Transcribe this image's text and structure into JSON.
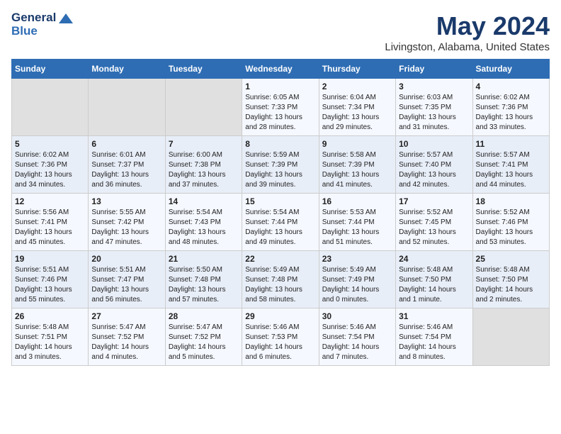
{
  "logo": {
    "line1": "General",
    "line2": "Blue"
  },
  "title": "May 2024",
  "subtitle": "Livingston, Alabama, United States",
  "days_header": [
    "Sunday",
    "Monday",
    "Tuesday",
    "Wednesday",
    "Thursday",
    "Friday",
    "Saturday"
  ],
  "weeks": [
    [
      {
        "day": "",
        "content": ""
      },
      {
        "day": "",
        "content": ""
      },
      {
        "day": "",
        "content": ""
      },
      {
        "day": "1",
        "content": "Sunrise: 6:05 AM\nSunset: 7:33 PM\nDaylight: 13 hours\nand 28 minutes."
      },
      {
        "day": "2",
        "content": "Sunrise: 6:04 AM\nSunset: 7:34 PM\nDaylight: 13 hours\nand 29 minutes."
      },
      {
        "day": "3",
        "content": "Sunrise: 6:03 AM\nSunset: 7:35 PM\nDaylight: 13 hours\nand 31 minutes."
      },
      {
        "day": "4",
        "content": "Sunrise: 6:02 AM\nSunset: 7:36 PM\nDaylight: 13 hours\nand 33 minutes."
      }
    ],
    [
      {
        "day": "5",
        "content": "Sunrise: 6:02 AM\nSunset: 7:36 PM\nDaylight: 13 hours\nand 34 minutes."
      },
      {
        "day": "6",
        "content": "Sunrise: 6:01 AM\nSunset: 7:37 PM\nDaylight: 13 hours\nand 36 minutes."
      },
      {
        "day": "7",
        "content": "Sunrise: 6:00 AM\nSunset: 7:38 PM\nDaylight: 13 hours\nand 37 minutes."
      },
      {
        "day": "8",
        "content": "Sunrise: 5:59 AM\nSunset: 7:39 PM\nDaylight: 13 hours\nand 39 minutes."
      },
      {
        "day": "9",
        "content": "Sunrise: 5:58 AM\nSunset: 7:39 PM\nDaylight: 13 hours\nand 41 minutes."
      },
      {
        "day": "10",
        "content": "Sunrise: 5:57 AM\nSunset: 7:40 PM\nDaylight: 13 hours\nand 42 minutes."
      },
      {
        "day": "11",
        "content": "Sunrise: 5:57 AM\nSunset: 7:41 PM\nDaylight: 13 hours\nand 44 minutes."
      }
    ],
    [
      {
        "day": "12",
        "content": "Sunrise: 5:56 AM\nSunset: 7:41 PM\nDaylight: 13 hours\nand 45 minutes."
      },
      {
        "day": "13",
        "content": "Sunrise: 5:55 AM\nSunset: 7:42 PM\nDaylight: 13 hours\nand 47 minutes."
      },
      {
        "day": "14",
        "content": "Sunrise: 5:54 AM\nSunset: 7:43 PM\nDaylight: 13 hours\nand 48 minutes."
      },
      {
        "day": "15",
        "content": "Sunrise: 5:54 AM\nSunset: 7:44 PM\nDaylight: 13 hours\nand 49 minutes."
      },
      {
        "day": "16",
        "content": "Sunrise: 5:53 AM\nSunset: 7:44 PM\nDaylight: 13 hours\nand 51 minutes."
      },
      {
        "day": "17",
        "content": "Sunrise: 5:52 AM\nSunset: 7:45 PM\nDaylight: 13 hours\nand 52 minutes."
      },
      {
        "day": "18",
        "content": "Sunrise: 5:52 AM\nSunset: 7:46 PM\nDaylight: 13 hours\nand 53 minutes."
      }
    ],
    [
      {
        "day": "19",
        "content": "Sunrise: 5:51 AM\nSunset: 7:46 PM\nDaylight: 13 hours\nand 55 minutes."
      },
      {
        "day": "20",
        "content": "Sunrise: 5:51 AM\nSunset: 7:47 PM\nDaylight: 13 hours\nand 56 minutes."
      },
      {
        "day": "21",
        "content": "Sunrise: 5:50 AM\nSunset: 7:48 PM\nDaylight: 13 hours\nand 57 minutes."
      },
      {
        "day": "22",
        "content": "Sunrise: 5:49 AM\nSunset: 7:48 PM\nDaylight: 13 hours\nand 58 minutes."
      },
      {
        "day": "23",
        "content": "Sunrise: 5:49 AM\nSunset: 7:49 PM\nDaylight: 14 hours\nand 0 minutes."
      },
      {
        "day": "24",
        "content": "Sunrise: 5:48 AM\nSunset: 7:50 PM\nDaylight: 14 hours\nand 1 minute."
      },
      {
        "day": "25",
        "content": "Sunrise: 5:48 AM\nSunset: 7:50 PM\nDaylight: 14 hours\nand 2 minutes."
      }
    ],
    [
      {
        "day": "26",
        "content": "Sunrise: 5:48 AM\nSunset: 7:51 PM\nDaylight: 14 hours\nand 3 minutes."
      },
      {
        "day": "27",
        "content": "Sunrise: 5:47 AM\nSunset: 7:52 PM\nDaylight: 14 hours\nand 4 minutes."
      },
      {
        "day": "28",
        "content": "Sunrise: 5:47 AM\nSunset: 7:52 PM\nDaylight: 14 hours\nand 5 minutes."
      },
      {
        "day": "29",
        "content": "Sunrise: 5:46 AM\nSunset: 7:53 PM\nDaylight: 14 hours\nand 6 minutes."
      },
      {
        "day": "30",
        "content": "Sunrise: 5:46 AM\nSunset: 7:54 PM\nDaylight: 14 hours\nand 7 minutes."
      },
      {
        "day": "31",
        "content": "Sunrise: 5:46 AM\nSunset: 7:54 PM\nDaylight: 14 hours\nand 8 minutes."
      },
      {
        "day": "",
        "content": ""
      }
    ]
  ]
}
